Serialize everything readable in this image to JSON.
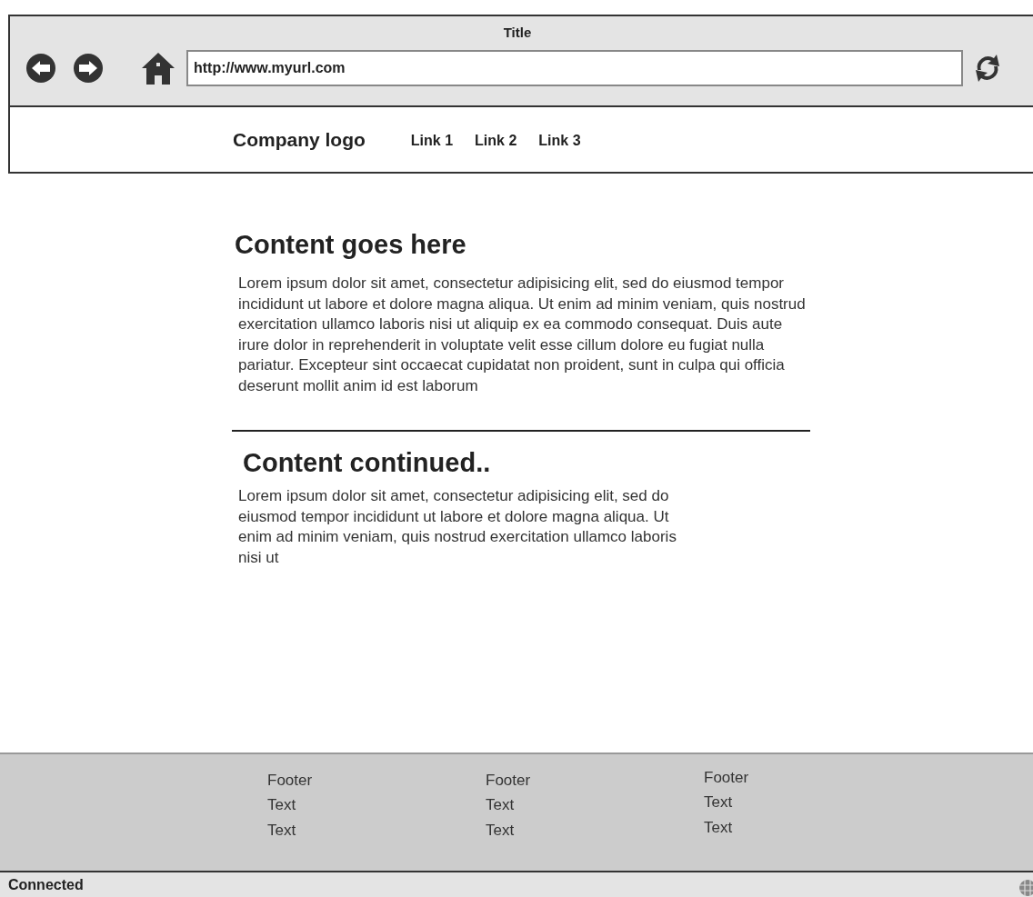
{
  "window": {
    "title": "Title"
  },
  "address_bar": {
    "value": "http://www.myurl.com"
  },
  "header": {
    "logo": "Company logo",
    "links": [
      "Link 1",
      "Link 2",
      "Link 3"
    ]
  },
  "sections": [
    {
      "heading": "Content goes here",
      "body": "Lorem ipsum dolor sit amet, consectetur adipisicing elit, sed do eiusmod tempor incididunt ut labore et dolore magna aliqua. Ut enim ad minim veniam, quis nostrud exercitation ullamco laboris nisi ut aliquip ex ea commodo consequat. Duis aute irure dolor in reprehenderit in voluptate velit esse cillum dolore eu fugiat nulla pariatur. Excepteur sint occaecat cupidatat non proident, sunt in culpa qui officia deserunt mollit anim id est laborum"
    },
    {
      "heading": "Content continued..",
      "body": "Lorem ipsum dolor sit amet, consectetur adipisicing elit, sed do eiusmod tempor incididunt ut labore et dolore magna aliqua. Ut enim ad minim veniam, quis nostrud exercitation ullamco laboris nisi ut"
    }
  ],
  "footer": {
    "columns": [
      [
        "Footer",
        "Text",
        "Text"
      ],
      [
        "Footer",
        "Text",
        "Text"
      ],
      [
        "Footer",
        "Text",
        "Text"
      ]
    ]
  },
  "status_bar": {
    "text": "Connected"
  }
}
